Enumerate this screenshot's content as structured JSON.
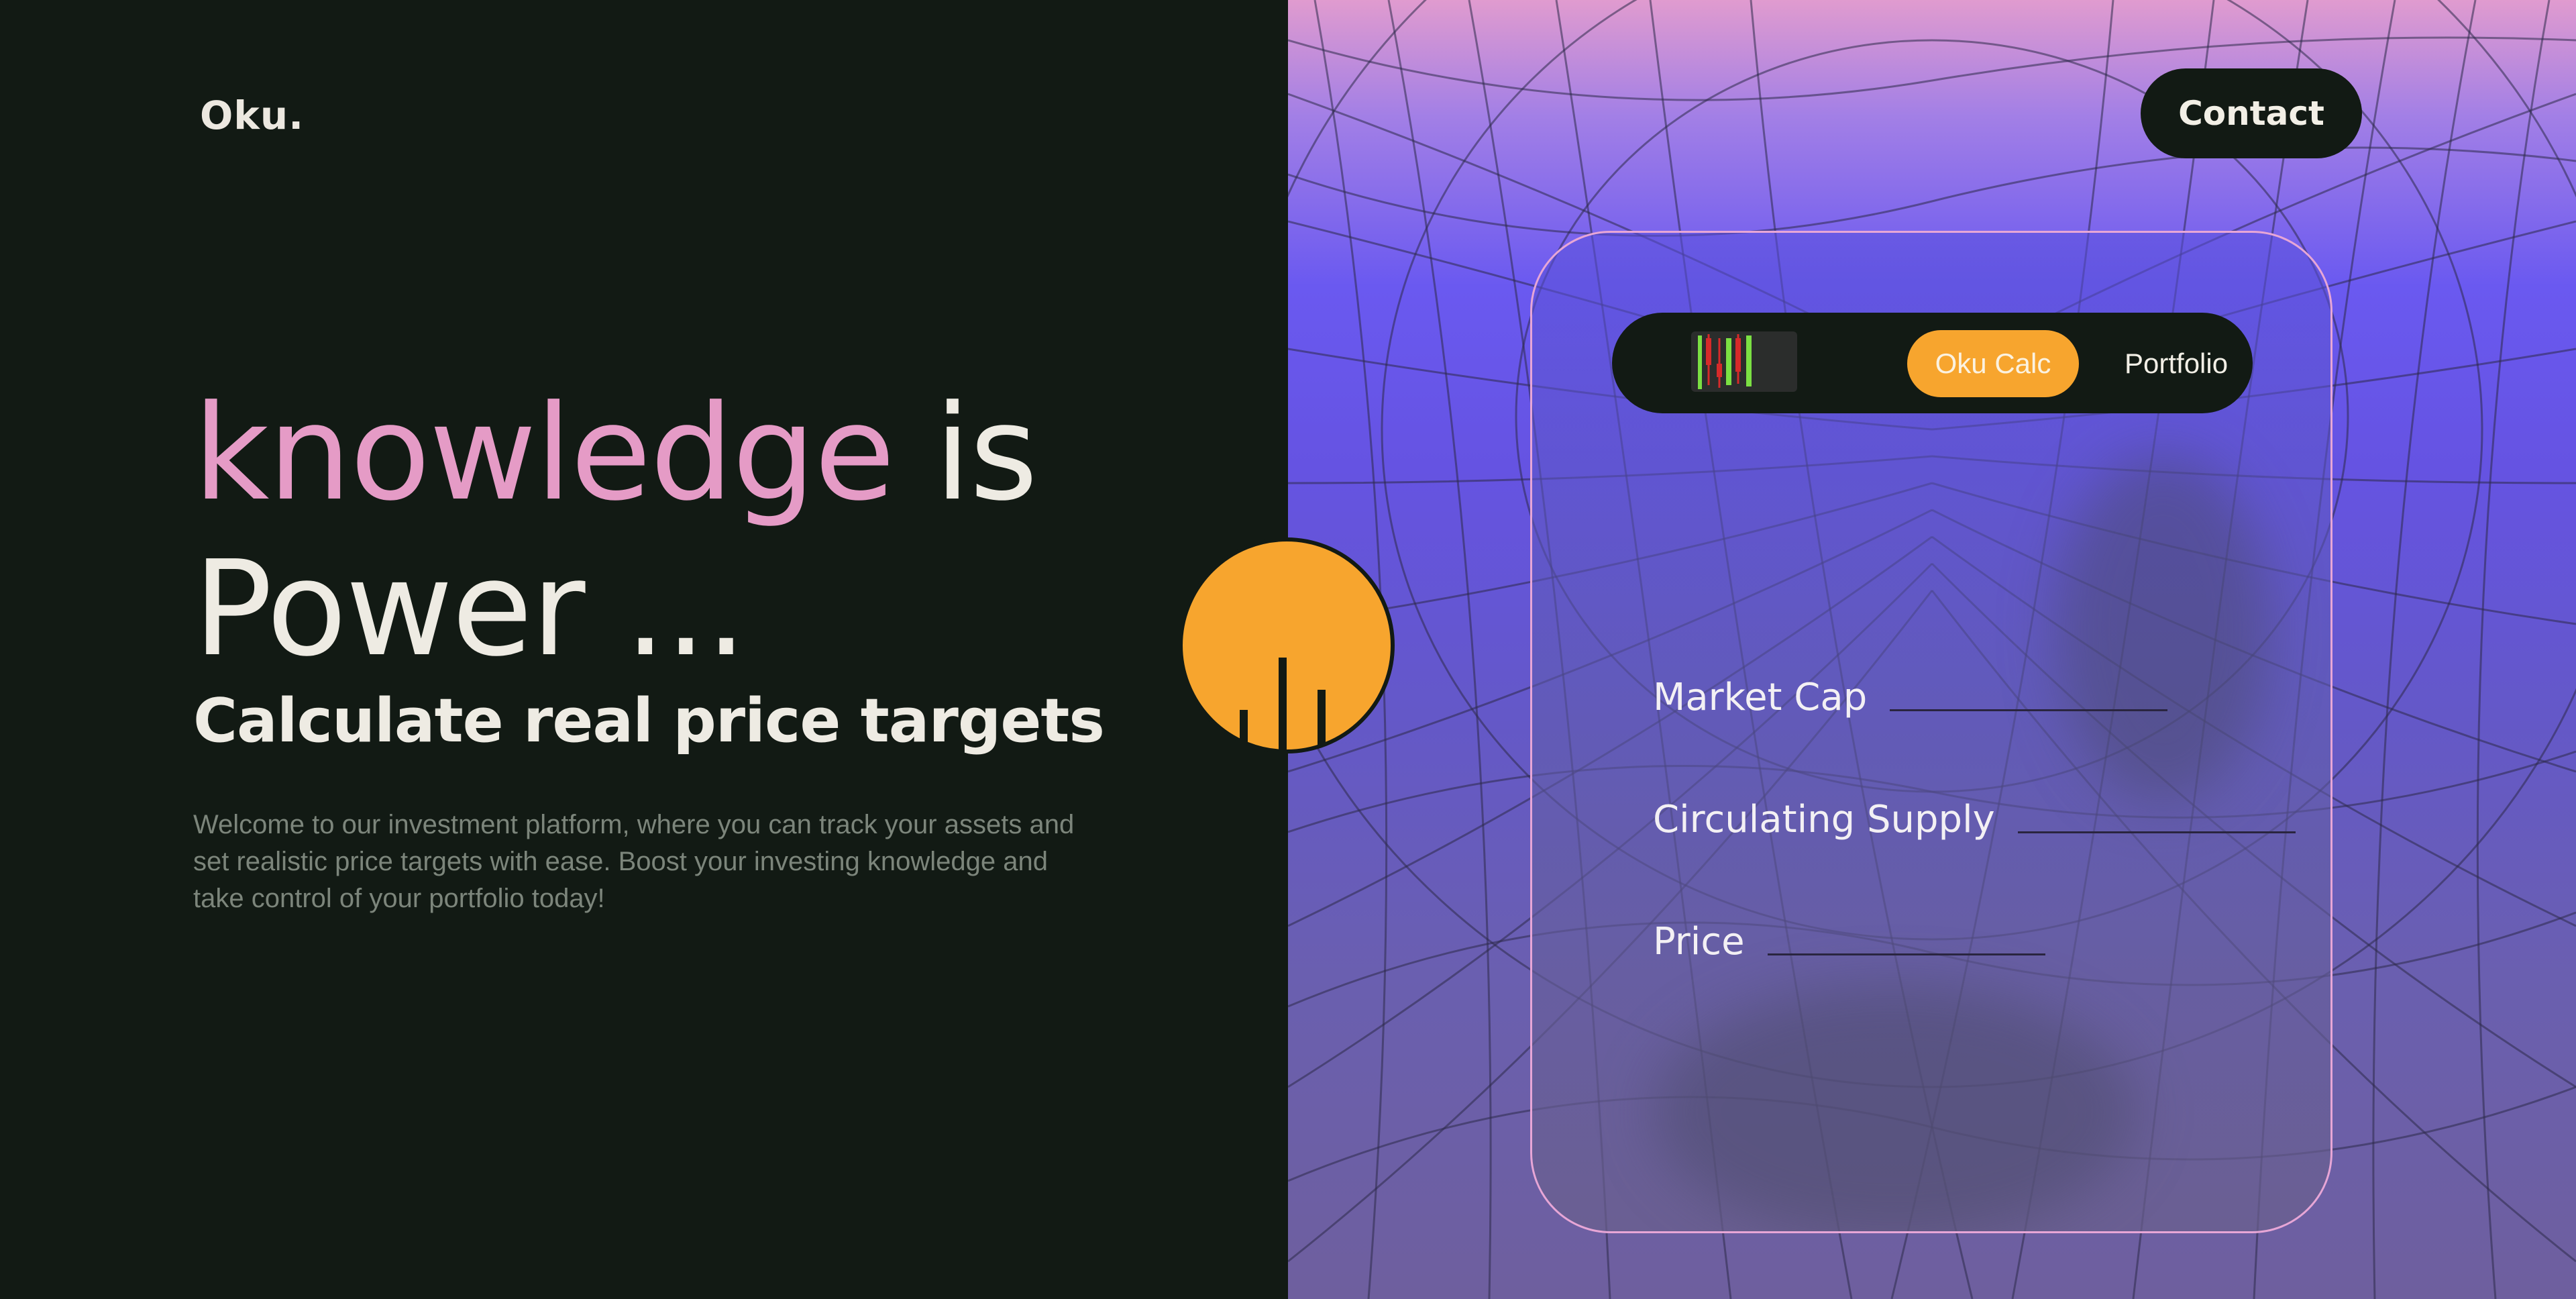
{
  "brand": {
    "logo": "Oku."
  },
  "hero": {
    "headline_highlight": "knowledge",
    "headline_rest_line1": "is",
    "headline_line2": "Power ...",
    "subheadline": "Calculate real price targets",
    "intro": "Welcome to our investment platform, where you can track your assets and set realistic price targets with ease. Boost your investing knowledge and take control of your portfolio today!"
  },
  "header": {
    "contact_label": "Contact"
  },
  "calculator": {
    "nav": {
      "logo_icon": "candlestick-chart-icon",
      "active_tab": "Oku Calc",
      "portfolio_link": "Portfolio"
    },
    "fields": [
      {
        "label": "Market Cap",
        "value": ""
      },
      {
        "label": "Circulating Supply",
        "value": ""
      },
      {
        "label": "Price",
        "value": ""
      }
    ]
  },
  "colors": {
    "background_dark": "#121a14",
    "accent_pink": "#e59bc6",
    "accent_orange": "#f7a52e",
    "text_light": "#eeebe3",
    "text_muted": "#7c857b",
    "panel_purple": "#6a59f0"
  },
  "icons": {
    "badge": "bar-chart-icon"
  }
}
